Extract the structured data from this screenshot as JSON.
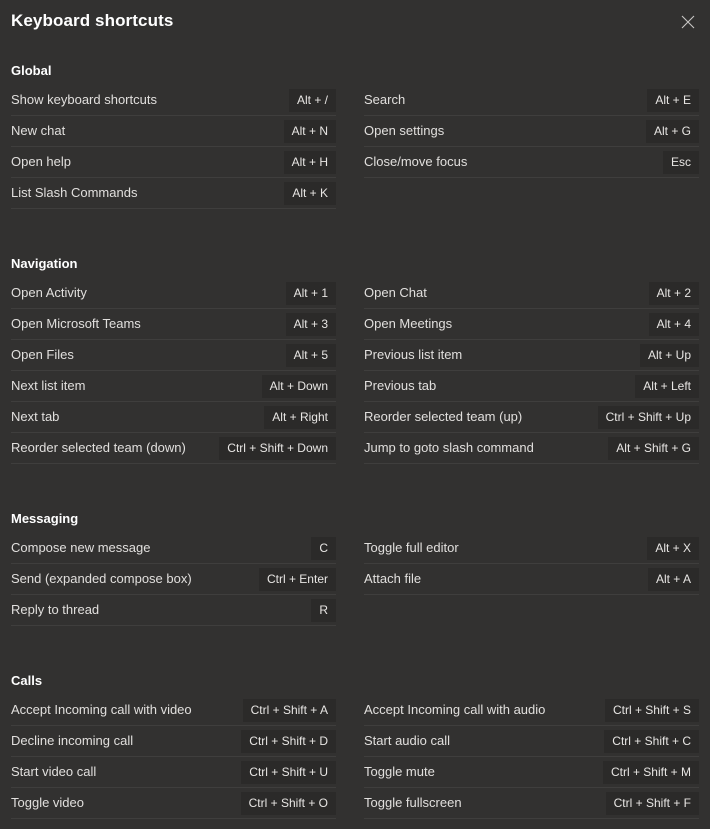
{
  "dialog": {
    "title": "Keyboard shortcuts",
    "close_label": "Close",
    "close_icon": "close-icon",
    "background_color": "#323130",
    "chip_color": "#2b2a29",
    "divider_color": "#3f3e3d",
    "text_color": "#e1dfdd",
    "heading_color": "#ffffff"
  },
  "sections": [
    {
      "title": "Global",
      "left": [
        {
          "label": "Show keyboard shortcuts",
          "keys": "Alt + /"
        },
        {
          "label": "New chat",
          "keys": "Alt + N"
        },
        {
          "label": "Open help",
          "keys": "Alt + H"
        },
        {
          "label": "List Slash Commands",
          "keys": "Alt + K"
        }
      ],
      "right": [
        {
          "label": "Search",
          "keys": "Alt + E"
        },
        {
          "label": "Open settings",
          "keys": "Alt + G"
        },
        {
          "label": "Close/move focus",
          "keys": "Esc"
        }
      ]
    },
    {
      "title": "Navigation",
      "left": [
        {
          "label": "Open Activity",
          "keys": "Alt + 1"
        },
        {
          "label": "Open Microsoft Teams",
          "keys": "Alt + 3"
        },
        {
          "label": "Open Files",
          "keys": "Alt + 5"
        },
        {
          "label": "Next list item",
          "keys": "Alt + Down"
        },
        {
          "label": "Next tab",
          "keys": "Alt + Right"
        },
        {
          "label": "Reorder selected team (down)",
          "keys": "Ctrl + Shift + Down"
        }
      ],
      "right": [
        {
          "label": "Open Chat",
          "keys": "Alt + 2"
        },
        {
          "label": "Open Meetings",
          "keys": "Alt + 4"
        },
        {
          "label": "Previous list item",
          "keys": "Alt + Up"
        },
        {
          "label": "Previous tab",
          "keys": "Alt + Left"
        },
        {
          "label": "Reorder selected team (up)",
          "keys": "Ctrl + Shift + Up"
        },
        {
          "label": "Jump to goto slash command",
          "keys": "Alt + Shift + G"
        }
      ]
    },
    {
      "title": "Messaging",
      "left": [
        {
          "label": "Compose new message",
          "keys": "C"
        },
        {
          "label": "Send (expanded compose box)",
          "keys": "Ctrl + Enter"
        },
        {
          "label": "Reply to thread",
          "keys": "R"
        }
      ],
      "right": [
        {
          "label": "Toggle full editor",
          "keys": "Alt + X"
        },
        {
          "label": "Attach file",
          "keys": "Alt + A"
        }
      ]
    },
    {
      "title": "Calls",
      "left": [
        {
          "label": "Accept Incoming call with video",
          "keys": "Ctrl + Shift + A"
        },
        {
          "label": "Decline incoming call",
          "keys": "Ctrl + Shift + D"
        },
        {
          "label": "Start video call",
          "keys": "Ctrl + Shift + U"
        },
        {
          "label": "Toggle video",
          "keys": "Ctrl + Shift + O"
        }
      ],
      "right": [
        {
          "label": "Accept Incoming call with audio",
          "keys": "Ctrl + Shift + S"
        },
        {
          "label": "Start audio call",
          "keys": "Ctrl + Shift + C"
        },
        {
          "label": "Toggle mute",
          "keys": "Ctrl + Shift + M"
        },
        {
          "label": "Toggle fullscreen",
          "keys": "Ctrl + Shift + F"
        }
      ]
    }
  ]
}
